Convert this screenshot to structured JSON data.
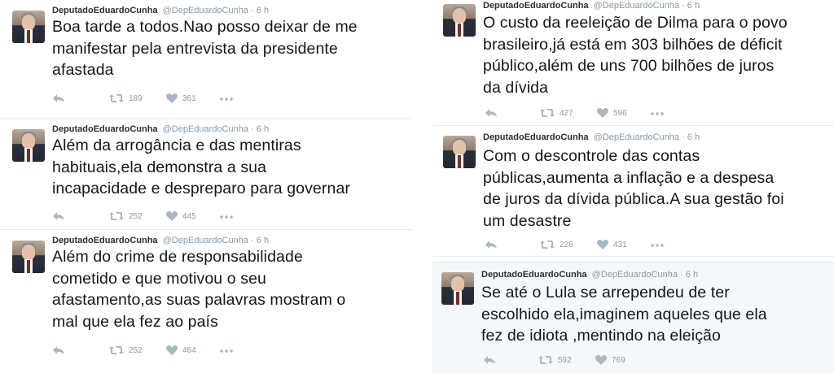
{
  "tweets": [
    {
      "name": "DeputadoEduardoCunha",
      "handle": "@DepEduardoCunha",
      "sep": "·",
      "time": "6 h",
      "text": "Boa tarde a todos.Nao posso deixar de me\nmanifestar pela entrevista da presidente\nafastada",
      "retweets": "189",
      "likes": "361"
    },
    {
      "name": "DeputadoEduardoCunha",
      "handle": "@DepEduardoCunha",
      "sep": "·",
      "time": "6 h",
      "text": "Além da arrogância e das mentiras\nhabituais,ela demonstra a sua\nincapacidade e despreparo para governar",
      "retweets": "252",
      "likes": "445"
    },
    {
      "name": "DeputadoEduardoCunha",
      "handle": "@DepEduardoCunha",
      "sep": "·",
      "time": "6 h",
      "text": "Além do crime de responsabilidade\ncometido e que motivou o seu\nafastamento,as suas palavras mostram o\nmal que ela fez ao país",
      "retweets": "252",
      "likes": "464"
    },
    {
      "name": "DeputadoEduardoCunha",
      "handle": "@DepEduardoCunha",
      "sep": "·",
      "time": "6 h",
      "text": "O custo da reeleição de Dilma para o povo\nbrasileiro,já está em 303 bilhões de déficit\npúblico,além de uns 700 bilhões de juros\nda dívida",
      "retweets": "427",
      "likes": "596"
    },
    {
      "name": "DeputadoEduardoCunha",
      "handle": "@DepEduardoCunha",
      "sep": "·",
      "time": "6 h",
      "text": "Com o descontrole das contas\npúblicas,aumenta a inflação e a despesa\nde juros da dívida pública.A sua gestão foi\num desastre",
      "retweets": "226",
      "likes": "431"
    },
    {
      "name": "DeputadoEduardoCunha",
      "handle": "@DepEduardoCunha",
      "sep": "·",
      "time": "6 h",
      "text": "Se até o Lula se arrependeu de ter\nescolhido ela,imaginem aqueles que ela\nfez de idiota ,mentindo na eleição",
      "retweets": "592",
      "likes": "769"
    }
  ],
  "icons": {
    "reply": "reply-icon",
    "retweet": "retweet-icon",
    "like": "heart-icon",
    "more": "more-icon"
  },
  "colors": {
    "icon": "#aab8c2",
    "secondary_text": "#8899a6",
    "highlight_bg": "#f5f8fa"
  }
}
